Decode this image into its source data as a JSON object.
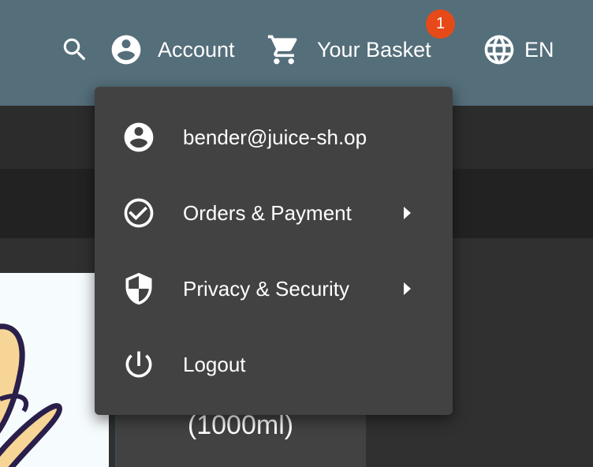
{
  "toolbar": {
    "account_label": "Account",
    "basket_label": "Your Basket",
    "basket_count": "1",
    "language_label": "EN"
  },
  "menu": {
    "items": [
      {
        "label": "bender@juice-sh.op",
        "icon": "account-circle-icon",
        "has_submenu": false
      },
      {
        "label": "Orders & Payment",
        "icon": "check-circle-icon",
        "has_submenu": true
      },
      {
        "label": "Privacy & Security",
        "icon": "shield-icon",
        "has_submenu": true
      },
      {
        "label": "Logout",
        "icon": "power-icon",
        "has_submenu": false
      }
    ]
  },
  "product": {
    "name_line2": "(1000ml)"
  },
  "colors": {
    "toolbar": "#546E7A",
    "badge": "#E64A19",
    "menu_bg": "#424242",
    "page_bg": "#303030"
  }
}
